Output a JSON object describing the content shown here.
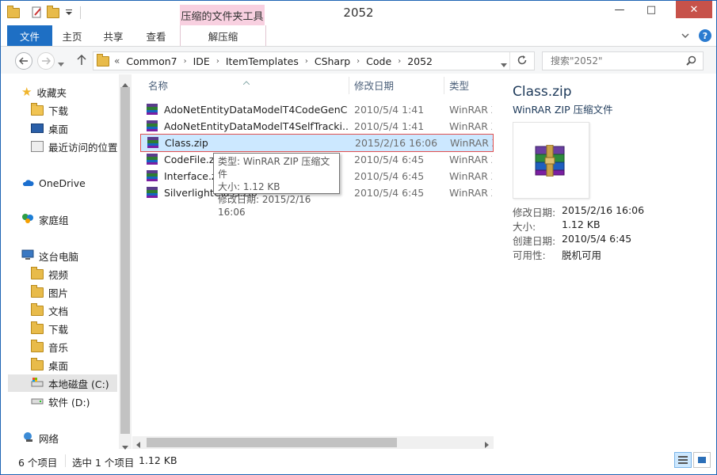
{
  "window": {
    "title": "2052",
    "controls": {
      "minimize": "—",
      "maximize": "□",
      "close": "✕"
    }
  },
  "contextual_tab_header": "压缩的文件夹工具",
  "ribbon_tabs": {
    "file": "文件",
    "home": "主页",
    "share": "共享",
    "view": "查看",
    "extract": "解压缩"
  },
  "breadcrumb": {
    "overflow": "«",
    "items": [
      "Common7",
      "IDE",
      "ItemTemplates",
      "CSharp",
      "Code",
      "2052"
    ]
  },
  "search": {
    "placeholder": "搜索\"2052\""
  },
  "nav": {
    "favorites": "收藏夹",
    "downloads": "下载",
    "desktop": "桌面",
    "recent": "最近访问的位置",
    "onedrive": "OneDrive",
    "homegroup": "家庭组",
    "thispc": "这台电脑",
    "videos": "视频",
    "pictures": "图片",
    "documents": "文档",
    "downloads2": "下载",
    "music": "音乐",
    "desktop2": "桌面",
    "local_disk": "本地磁盘 (C:)",
    "software": "软件 (D:)",
    "network": "网络"
  },
  "columns": {
    "name": "名称",
    "date": "修改日期",
    "type": "类型"
  },
  "files": [
    {
      "name": "AdoNetEntityDataModelT4CodeGenC...",
      "date": "2010/5/4 1:41",
      "type": "WinRAR ZIP"
    },
    {
      "name": "AdoNetEntityDataModelT4SelfTracki...",
      "date": "2010/5/4 1:41",
      "type": "WinRAR ZIP"
    },
    {
      "name": "Class.zip",
      "date": "2015/2/16 16:06",
      "type": "WinRAR ZIP"
    },
    {
      "name": "CodeFile.zip",
      "date": "2010/5/4 6:45",
      "type": "WinRAR ZIP"
    },
    {
      "name": "Interface.zip",
      "date": "2010/5/4 6:45",
      "type": "WinRAR ZIP"
    },
    {
      "name": "SilverlightClass.zip",
      "date": "2010/5/4 6:45",
      "type": "WinRAR ZIP"
    }
  ],
  "tooltip": {
    "type": "类型: WinRAR ZIP 压缩文件",
    "size": "大小: 1.12 KB",
    "modified": "修改日期: 2015/2/16 16:06"
  },
  "preview": {
    "filename": "Class.zip",
    "filetype": "WinRAR ZIP 压缩文件",
    "props": [
      {
        "k": "修改日期:",
        "v": "2015/2/16 16:06"
      },
      {
        "k": "大小:",
        "v": "1.12 KB"
      },
      {
        "k": "创建日期:",
        "v": "2010/5/4 6:45"
      },
      {
        "k": "可用性:",
        "v": "脱机可用"
      }
    ]
  },
  "status": {
    "count": "6 个项目",
    "selected": "选中 1 个项目",
    "size": "1.12 KB"
  },
  "colors": {
    "accent": "#1e6fc4",
    "context_tab": "#f8d0e0",
    "selection": "#cce8ff",
    "selection_border": "#e05050",
    "close": "#c7524a"
  }
}
